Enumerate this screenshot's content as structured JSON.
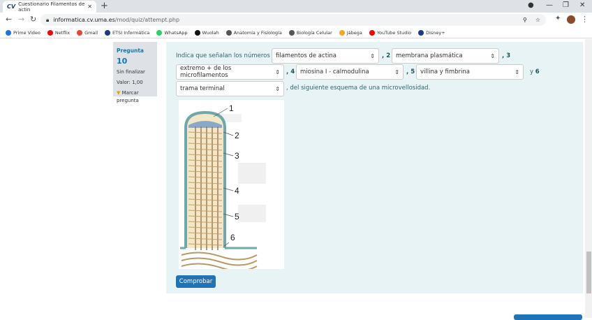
{
  "browser": {
    "tab_title": "Cuestionario Filamentos de actin",
    "tab_logo": "CV",
    "url_host": "informatica.cv.uma.es",
    "url_path": "/mod/quiz/attempt.php"
  },
  "bookmarks": [
    {
      "label": "Prime Video",
      "color": "#1a73e8"
    },
    {
      "label": "Netflix",
      "color": "#e50914"
    },
    {
      "label": "Gmail",
      "color": "#ea4335"
    },
    {
      "label": "ETSI Informática",
      "color": "#1d3a7a"
    },
    {
      "label": "WhatsApp",
      "color": "#25d366"
    },
    {
      "label": "Wuolah",
      "color": "#111111"
    },
    {
      "label": "Anatomía y Fisiología",
      "color": "#555555"
    },
    {
      "label": "Biología Celular",
      "color": "#555555"
    },
    {
      "label": "Jábega",
      "color": "#f5a623"
    },
    {
      "label": "YouTube Studio",
      "color": "#ff0000"
    },
    {
      "label": "Disney+",
      "color": "#1a3a8a"
    }
  ],
  "info": {
    "question_label": "Pregunta",
    "question_number": "10",
    "status": "Sin finalizar",
    "value": "Valor: 1,00",
    "flag": "Marcar pregunta"
  },
  "question": {
    "intro": "Indica que señalan los números",
    "n1": "1",
    "n2": ", 2",
    "n3": ", 3",
    "n4": ", 4",
    "n5": ", 5",
    "n6a": "y",
    "n6": "6",
    "end": ",  del siguiente esquema de una microvellosidad.",
    "answers": [
      "filamentos de actina",
      "membrana plasmática",
      "extremo + de los microfilamentos",
      "miosina I - calmodulina",
      "villina y fimbrina",
      "trama terminal"
    ],
    "diagram_labels": [
      "1",
      "2",
      "3",
      "4",
      "5",
      "6"
    ],
    "submit": "Comprobar"
  }
}
